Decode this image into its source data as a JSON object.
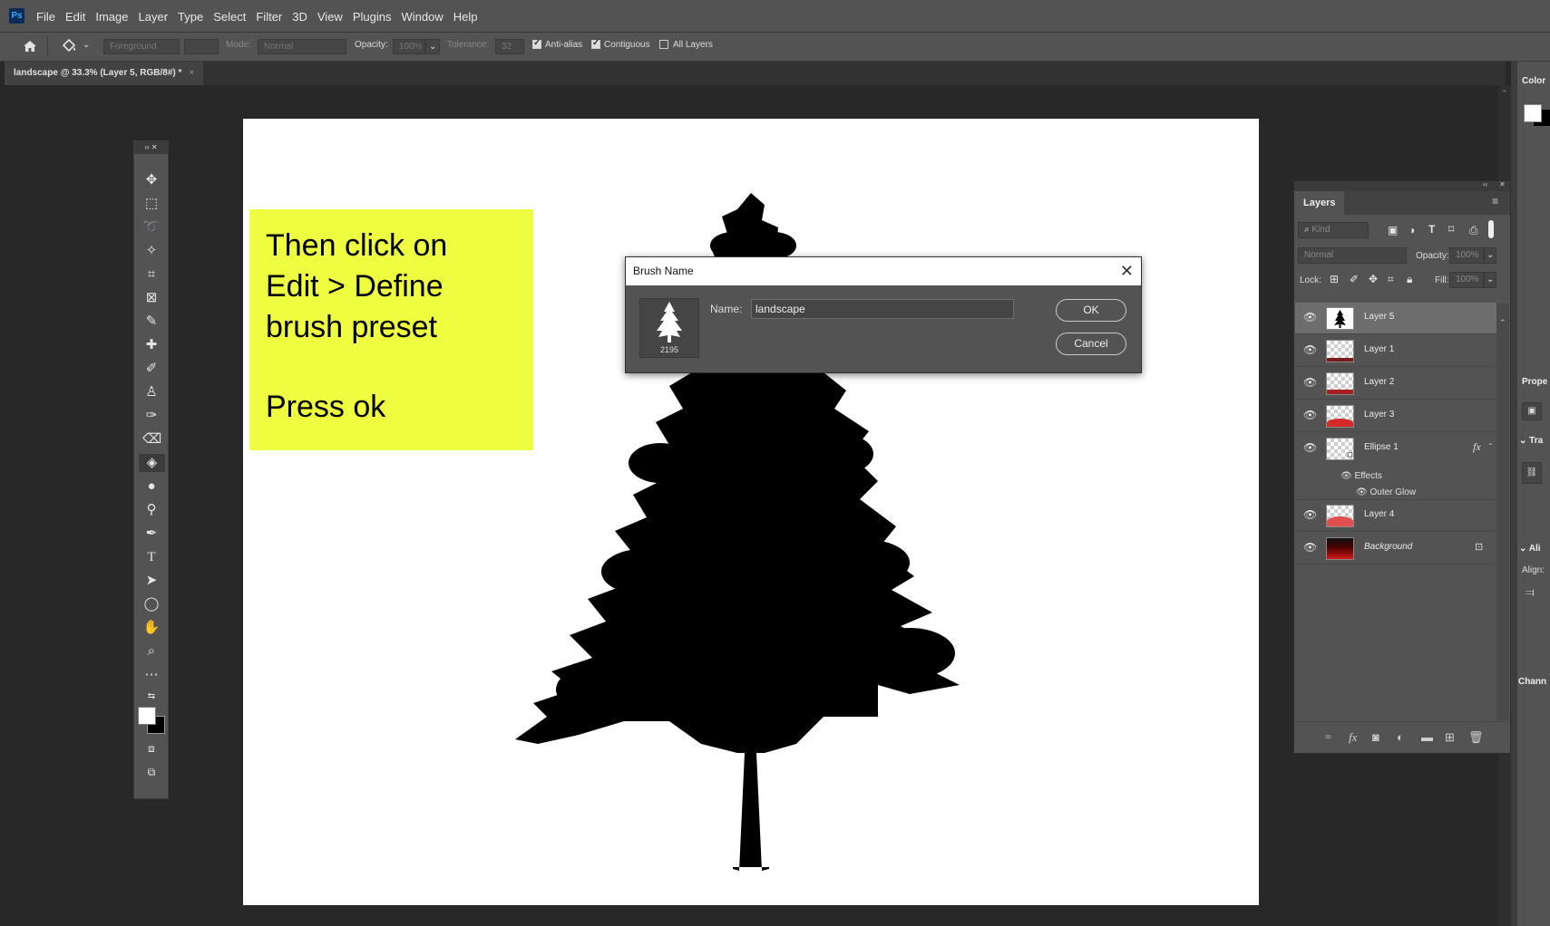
{
  "app": {
    "logo": "Ps"
  },
  "menu": [
    "File",
    "Edit",
    "Image",
    "Layer",
    "Type",
    "Select",
    "Filter",
    "3D",
    "View",
    "Plugins",
    "Window",
    "Help"
  ],
  "options": {
    "fill_source": "Foreground",
    "mode_label": "Mode:",
    "mode_value": "Normal",
    "opacity_label": "Opacity:",
    "opacity_value": "100%",
    "tolerance_label": "Tolerance:",
    "tolerance_value": "32",
    "antialias_label": "Anti-alias",
    "antialias_checked": true,
    "contiguous_label": "Contiguous",
    "contiguous_checked": true,
    "all_layers_label": "All Layers",
    "all_layers_checked": false
  },
  "document_tab": {
    "title": "landscape @ 33.3% (Layer 5, RGB/8#) *",
    "close": "×"
  },
  "note": {
    "lines": [
      "Then click on",
      "Edit > Define",
      "brush preset",
      "",
      "Press ok"
    ]
  },
  "dialog": {
    "title": "Brush Name",
    "close": "✕",
    "preview_size": "2195",
    "name_label": "Name:",
    "name_value": "landscape",
    "ok_label": "OK",
    "cancel_label": "Cancel"
  },
  "layers_panel": {
    "tab": "Layers",
    "filter_placeholder": "Kind",
    "blend_mode": "Normal",
    "opacity_label": "Opacity:",
    "opacity_value": "100%",
    "lock_label": "Lock:",
    "fill_label": "Fill:",
    "fill_value": "100%",
    "layers": [
      {
        "name": "Layer 5",
        "selected": true
      },
      {
        "name": "Layer 1"
      },
      {
        "name": "Layer 2"
      },
      {
        "name": "Layer 3"
      },
      {
        "name": "Ellipse 1",
        "fx": "fx",
        "effects_label": "Effects",
        "effect": "Outer Glow"
      },
      {
        "name": "Layer 4"
      },
      {
        "name": "Background",
        "locked": true
      }
    ]
  },
  "right_dock": {
    "color_label": "Color",
    "properties_label": "Prope",
    "transform_label": "Tra",
    "align_section": "Ali",
    "align_label": "Align:",
    "channels_label": "Chann"
  },
  "colors": {
    "ps_blue": "#31a8ff",
    "note_yellow": "#eefd40",
    "panel_gray": "#535353"
  }
}
